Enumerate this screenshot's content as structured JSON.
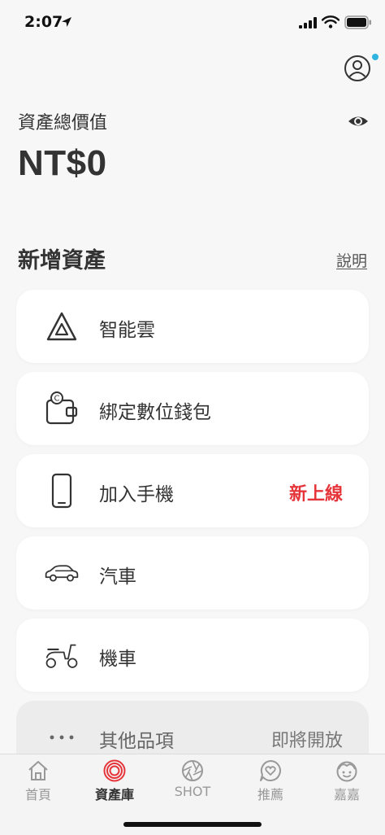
{
  "status_bar": {
    "time": "2:07"
  },
  "header": {
    "total_label": "資產總價值",
    "total_value": "NT$0"
  },
  "section": {
    "title": "新增資產",
    "help_label": "說明"
  },
  "assets": [
    {
      "label": "智能雲",
      "icon": "triangle-logo-icon",
      "badge": ""
    },
    {
      "label": "綁定數位錢包",
      "icon": "wallet-icon",
      "badge": ""
    },
    {
      "label": "加入手機",
      "icon": "phone-icon",
      "badge": "新上線"
    },
    {
      "label": "汽車",
      "icon": "car-icon",
      "badge": ""
    },
    {
      "label": "機車",
      "icon": "scooter-icon",
      "badge": ""
    },
    {
      "label": "其他品項",
      "icon": "more-icon",
      "badge": "即將開放"
    }
  ],
  "tabs": [
    {
      "label": "首頁",
      "icon": "home-icon",
      "active": false
    },
    {
      "label": "資產庫",
      "icon": "asset-ring-icon",
      "active": true
    },
    {
      "label": "SHOT",
      "icon": "camera-shutter-icon",
      "active": false
    },
    {
      "label": "推薦",
      "icon": "heart-bubble-icon",
      "active": false
    },
    {
      "label": "嘉嘉",
      "icon": "face-icon",
      "active": false
    }
  ],
  "colors": {
    "accent_red": "#e5353a",
    "notification_dot": "#2fb4e0",
    "background": "#f7f7f7",
    "card": "#ffffff"
  }
}
